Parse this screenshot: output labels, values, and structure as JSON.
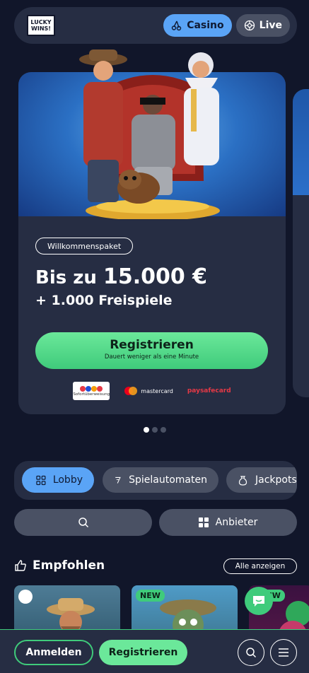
{
  "header": {
    "logo_line1": "LUCKY",
    "logo_line2": "WINS!",
    "tabs": [
      {
        "label": "Casino",
        "icon": "cherries-icon",
        "active": true
      },
      {
        "label": "Live",
        "icon": "roulette-icon",
        "active": false
      }
    ]
  },
  "promo": {
    "tag": "Willkommenspaket",
    "line1_prefix": "Bis zu",
    "line1_amount": "15.000 €",
    "line2": "+ 1.000 Freispiele",
    "cta_label": "Registrieren",
    "cta_sub": "Dauert weniger als eine Minute",
    "payments": {
      "sofort": "Sofortüberweisung",
      "mastercard": "mastercard",
      "paysafecard": "paysafecard"
    }
  },
  "carousel": {
    "count": 3,
    "active_index": 0
  },
  "categories": [
    {
      "label": "Lobby",
      "icon": "grid-icon",
      "active": true
    },
    {
      "label": "Spielautomaten",
      "icon": "slot-icon",
      "active": false
    },
    {
      "label": "Jackpots",
      "icon": "money-bag-icon",
      "active": false
    }
  ],
  "search": {
    "icon": "search-icon"
  },
  "providers": {
    "label": "Anbieter",
    "icon": "grid-icon"
  },
  "section": {
    "title": "Empfohlen",
    "icon": "thumbs-up-icon",
    "show_all": "Alle anzeigen"
  },
  "games": [
    {
      "badge": ""
    },
    {
      "badge": "NEW"
    },
    {
      "badge": "NEW"
    }
  ],
  "bottom": {
    "login": "Anmelden",
    "register": "Registrieren"
  },
  "colors": {
    "background": "#11162a",
    "panel": "#262d43",
    "accent_blue": "#5aa4f6",
    "accent_green": "#3fcb7b"
  }
}
